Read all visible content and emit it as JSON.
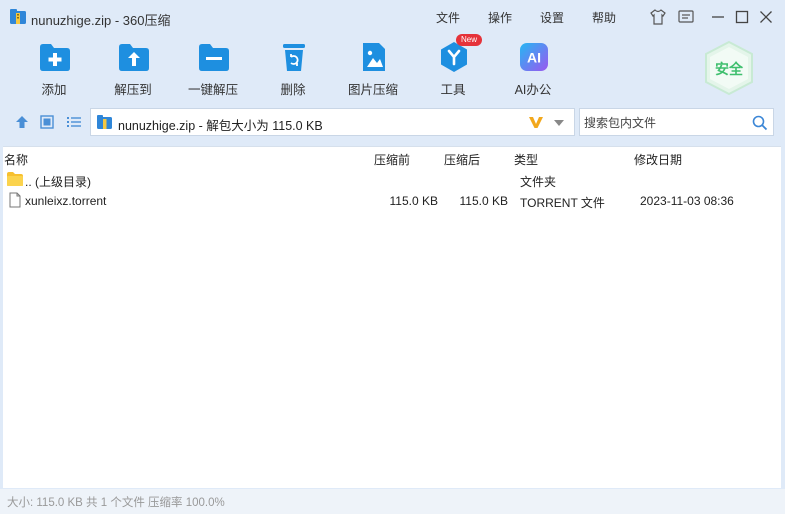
{
  "titlebar": {
    "title": "nunuzhige.zip - 360压缩",
    "menus": [
      "文件",
      "操作",
      "设置",
      "帮助"
    ]
  },
  "toolbar": {
    "items": [
      {
        "label": "添加",
        "icon": "add-folder-icon"
      },
      {
        "label": "解压到",
        "icon": "extract-to-icon"
      },
      {
        "label": "一键解压",
        "icon": "one-click-extract-icon"
      },
      {
        "label": "删除",
        "icon": "trash-icon"
      },
      {
        "label": "图片压缩",
        "icon": "image-compress-icon"
      },
      {
        "label": "工具",
        "icon": "tools-icon"
      },
      {
        "label": "AI办公",
        "icon": "ai-office-icon"
      }
    ],
    "new_badge": "New",
    "safe_label": "安全"
  },
  "address": {
    "path": "nunuzhige.zip - 解包大小为 115.0 KB"
  },
  "search": {
    "placeholder": "搜索包内文件"
  },
  "columns": {
    "name": "名称",
    "compressed_before": "压缩前",
    "compressed_after": "压缩后",
    "type": "类型",
    "modified": "修改日期"
  },
  "rows": [
    {
      "name": ".. (上级目录)",
      "before": "",
      "after": "",
      "type": "文件夹",
      "modified": "",
      "icon": "folder-icon"
    },
    {
      "name": "xunleixz.torrent",
      "before": "115.0 KB",
      "after": "115.0 KB",
      "type": "TORRENT 文件",
      "modified": "2023-11-03 08:36",
      "icon": "file-icon"
    }
  ],
  "status": {
    "text": "大小: 115.0 KB 共 1 个文件 压缩率 100.0%"
  },
  "colors": {
    "accent": "#1e8fe0",
    "window_bg": "#dfeaf8",
    "folder": "#f7c02f",
    "new_badge": "#e5333a",
    "safe_green": "#3fbf6e"
  }
}
